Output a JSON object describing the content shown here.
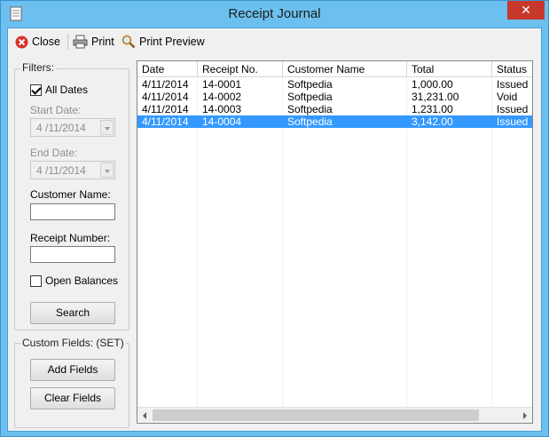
{
  "window": {
    "title": "Receipt Journal",
    "close_glyph": "✕"
  },
  "toolbar": {
    "close_label": "Close",
    "print_label": "Print",
    "print_preview_label": "Print Preview"
  },
  "filters": {
    "group_label": "Filters:",
    "all_dates_label": "All Dates",
    "all_dates_checked": true,
    "start_date_label": "Start Date:",
    "start_date_value": "4 /11/2014",
    "end_date_label": "End Date:",
    "end_date_value": "4 /11/2014",
    "customer_name_label": "Customer Name:",
    "customer_name_value": "",
    "receipt_number_label": "Receipt Number:",
    "receipt_number_value": "",
    "open_balances_label": "Open Balances",
    "open_balances_checked": false,
    "search_label": "Search"
  },
  "custom_fields": {
    "group_label": "Custom Fields:  (SET)",
    "add_label": "Add Fields",
    "clear_label": "Clear Fields"
  },
  "grid": {
    "columns": [
      "Date",
      "Receipt No.",
      "Customer Name",
      "Total",
      "Status"
    ],
    "rows": [
      [
        "4/11/2014",
        "14-0001",
        "Softpedia",
        "1,000.00",
        "Issued"
      ],
      [
        "4/11/2014",
        "14-0002",
        "Softpedia",
        "31,231.00",
        "Void"
      ],
      [
        "4/11/2014",
        "14-0003",
        "Softpedia",
        "1,231.00",
        "Issued"
      ],
      [
        "4/11/2014",
        "14-0004",
        "Softpedia",
        "3,142.00",
        "Issued"
      ]
    ],
    "selected_row": 3
  },
  "colors": {
    "selection": "#3399ff",
    "close_button": "#c7372c",
    "frame": "#6cc0ef"
  }
}
